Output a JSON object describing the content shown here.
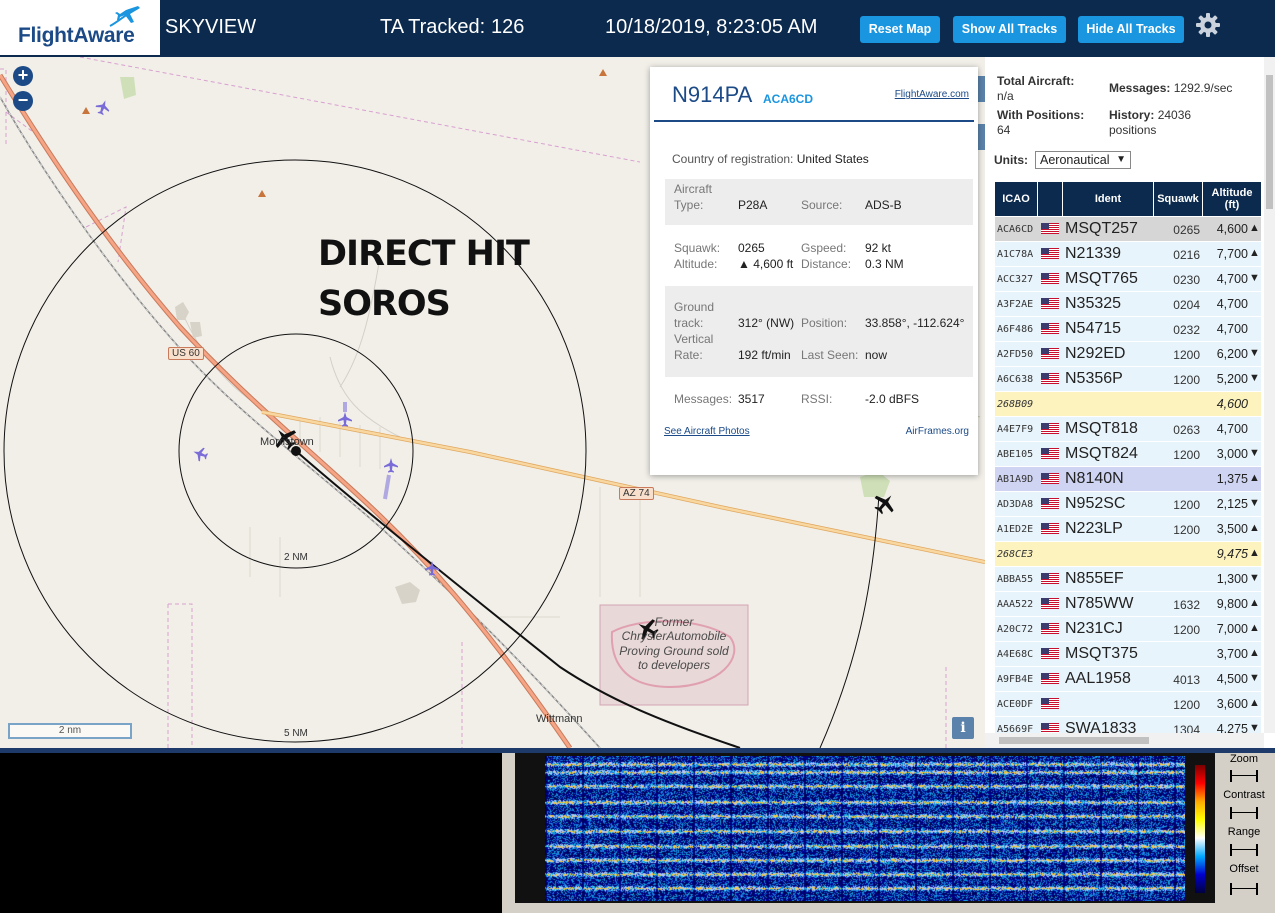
{
  "header": {
    "logo_text": "FlightAware",
    "app_name": "SKYVIEW",
    "ta_label": "TA Tracked:",
    "ta_count": "126",
    "datetime": "10/18/2019, 8:23:05 AM",
    "buttons": {
      "reset": "Reset Map",
      "show": "Show All Tracks",
      "hide": "Hide All Tracks"
    },
    "settings_icon": "gear-icon",
    "colors": {
      "bar": "#0b2a4e",
      "button": "#1a95e0"
    }
  },
  "map": {
    "overlay_text_line1": "DIRECT HIT",
    "overlay_text_line2": "SOROS",
    "place_label_town": "Morristown",
    "place_label_wittmann": "Wittmann",
    "range_ring_inner": "2 NM",
    "range_ring_outer": "5 NM",
    "road_us60": "US 60",
    "road_az74": "AZ 74",
    "proving_ground": "Former ChryslerAutomobile Proving Ground sold to developers",
    "scale_bar": "2 nm",
    "info_button": "i",
    "zoom_in": "+",
    "zoom_out": "−"
  },
  "popup": {
    "registration": "N914PA",
    "icao": "ACA6CD",
    "link_flightaware": "FlightAware.com",
    "country_label": "Country of registration:",
    "country": "United States",
    "aircraft_type_label": "Aircraft Type:",
    "aircraft_type": "P28A",
    "source_label": "Source:",
    "source": "ADS-B",
    "squawk_label": "Squawk:",
    "squawk": "0265",
    "altitude_label": "Altitude:",
    "altitude": "▲ 4,600 ft",
    "gspeed_label": "Gspeed:",
    "gspeed": "92 kt",
    "distance_label": "Distance:",
    "distance": "0.3 NM",
    "ground_track_label": "Ground track:",
    "ground_track": "312° (NW)",
    "position_label": "Position:",
    "position": "33.858°, -112.624°",
    "vertical_rate_label": "Vertical Rate:",
    "vertical_rate": "192 ft/min",
    "last_seen_label": "Last Seen:",
    "last_seen": "now",
    "messages_label": "Messages:",
    "messages": "3517",
    "rssi_label": "RSSI:",
    "rssi": "-2.0 dBFS",
    "link_photos": "See Aircraft Photos",
    "link_airframes": "AirFrames.org"
  },
  "sidebar": {
    "total_aircraft_label": "Total Aircraft:",
    "total_aircraft": "n/a",
    "with_positions_label": "With Positions:",
    "with_positions": "64",
    "messages_label": "Messages:",
    "messages": "1292.9/sec",
    "history_label": "History:",
    "history": "24036 positions",
    "units_label": "Units:",
    "units_value": "Aeronautical",
    "columns": [
      "ICAO",
      "",
      "Ident",
      "Squawk",
      "Altitude (ft)"
    ],
    "rows": [
      {
        "icao": "ACA6CD",
        "ident": "MSQT257",
        "squawk": "0265",
        "alt": "4,600",
        "trend": "▲",
        "flag": true,
        "style": "sel"
      },
      {
        "icao": "A1C78A",
        "ident": "N21339",
        "squawk": "0216",
        "alt": "7,700",
        "trend": "▲",
        "flag": true,
        "style": ""
      },
      {
        "icao": "ACC327",
        "ident": "MSQT765",
        "squawk": "0230",
        "alt": "4,700",
        "trend": "▼",
        "flag": true,
        "style": ""
      },
      {
        "icao": "A3F2AE",
        "ident": "N35325",
        "squawk": "0204",
        "alt": "4,700",
        "trend": "",
        "flag": true,
        "style": ""
      },
      {
        "icao": "A6F486",
        "ident": "N54715",
        "squawk": "0232",
        "alt": "4,700",
        "trend": "",
        "flag": true,
        "style": ""
      },
      {
        "icao": "A2FD50",
        "ident": "N292ED",
        "squawk": "1200",
        "alt": "6,200",
        "trend": "▼",
        "flag": true,
        "style": ""
      },
      {
        "icao": "A6C638",
        "ident": "N5356P",
        "squawk": "1200",
        "alt": "5,200",
        "trend": "▼",
        "flag": true,
        "style": ""
      },
      {
        "icao": "268B09",
        "ident": "",
        "squawk": "",
        "alt": "4,600",
        "trend": "",
        "flag": false,
        "style": "ghost"
      },
      {
        "icao": "A4E7F9",
        "ident": "MSQT818",
        "squawk": "0263",
        "alt": "4,700",
        "trend": "",
        "flag": true,
        "style": ""
      },
      {
        "icao": "ABE105",
        "ident": "MSQT824",
        "squawk": "1200",
        "alt": "3,000",
        "trend": "▼",
        "flag": true,
        "style": ""
      },
      {
        "icao": "AB1A9D",
        "ident": "N8140N",
        "squawk": "",
        "alt": "1,375",
        "trend": "▲",
        "flag": true,
        "style": "hl"
      },
      {
        "icao": "AD3DA8",
        "ident": "N952SC",
        "squawk": "1200",
        "alt": "2,125",
        "trend": "▼",
        "flag": true,
        "style": ""
      },
      {
        "icao": "A1ED2E",
        "ident": "N223LP",
        "squawk": "1200",
        "alt": "3,500",
        "trend": "▲",
        "flag": true,
        "style": ""
      },
      {
        "icao": "268CE3",
        "ident": "",
        "squawk": "",
        "alt": "9,475",
        "trend": "▲",
        "flag": false,
        "style": "ghost"
      },
      {
        "icao": "ABBA55",
        "ident": "N855EF",
        "squawk": "",
        "alt": "1,300",
        "trend": "▼",
        "flag": true,
        "style": ""
      },
      {
        "icao": "AAA522",
        "ident": "N785WW",
        "squawk": "1632",
        "alt": "9,800",
        "trend": "▲",
        "flag": true,
        "style": ""
      },
      {
        "icao": "A20C72",
        "ident": "N231CJ",
        "squawk": "1200",
        "alt": "7,000",
        "trend": "▲",
        "flag": true,
        "style": ""
      },
      {
        "icao": "A4E68C",
        "ident": "MSQT375",
        "squawk": "",
        "alt": "3,700",
        "trend": "▲",
        "flag": true,
        "style": ""
      },
      {
        "icao": "A9FB4E",
        "ident": "AAL1958",
        "squawk": "4013",
        "alt": "4,500",
        "trend": "▼",
        "flag": true,
        "style": ""
      },
      {
        "icao": "ACE0DF",
        "ident": "",
        "squawk": "1200",
        "alt": "3,600",
        "trend": "▲",
        "flag": true,
        "style": ""
      },
      {
        "icao": "A5669F",
        "ident": "SWA1833",
        "squawk": "1304",
        "alt": "4,275",
        "trend": "▼",
        "flag": true,
        "style": ""
      }
    ],
    "colors": {
      "header": "#0b2a4e",
      "row": "#e8f4fb",
      "selected": "#d6d6d6",
      "highlight": "#cfd4f2",
      "no_position": "#fcf3bf"
    }
  },
  "waterfall": {
    "zoom_label": "Zoom",
    "contrast_label": "Contrast",
    "range_label": "Range",
    "offset_label": "Offset"
  }
}
